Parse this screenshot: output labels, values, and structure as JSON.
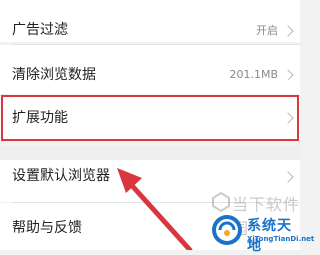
{
  "settings": {
    "items": [
      {
        "label": "广告过滤",
        "value": "开启"
      },
      {
        "label": "清除浏览数据",
        "value": "201.1MB"
      },
      {
        "label": "扩展功能",
        "value": ""
      },
      {
        "label": "设置默认浏览器",
        "value": ""
      },
      {
        "label": "帮助与反馈",
        "value": ""
      }
    ]
  },
  "annotation": {
    "highlight_color": "#d9363e",
    "arrow_color": "#d9363e"
  },
  "watermarks": {
    "top_text": "当下软件园",
    "brand_title": "系统天地",
    "brand_url": "XiTongTianDi.net",
    "brand_color": "#1a73c8"
  }
}
